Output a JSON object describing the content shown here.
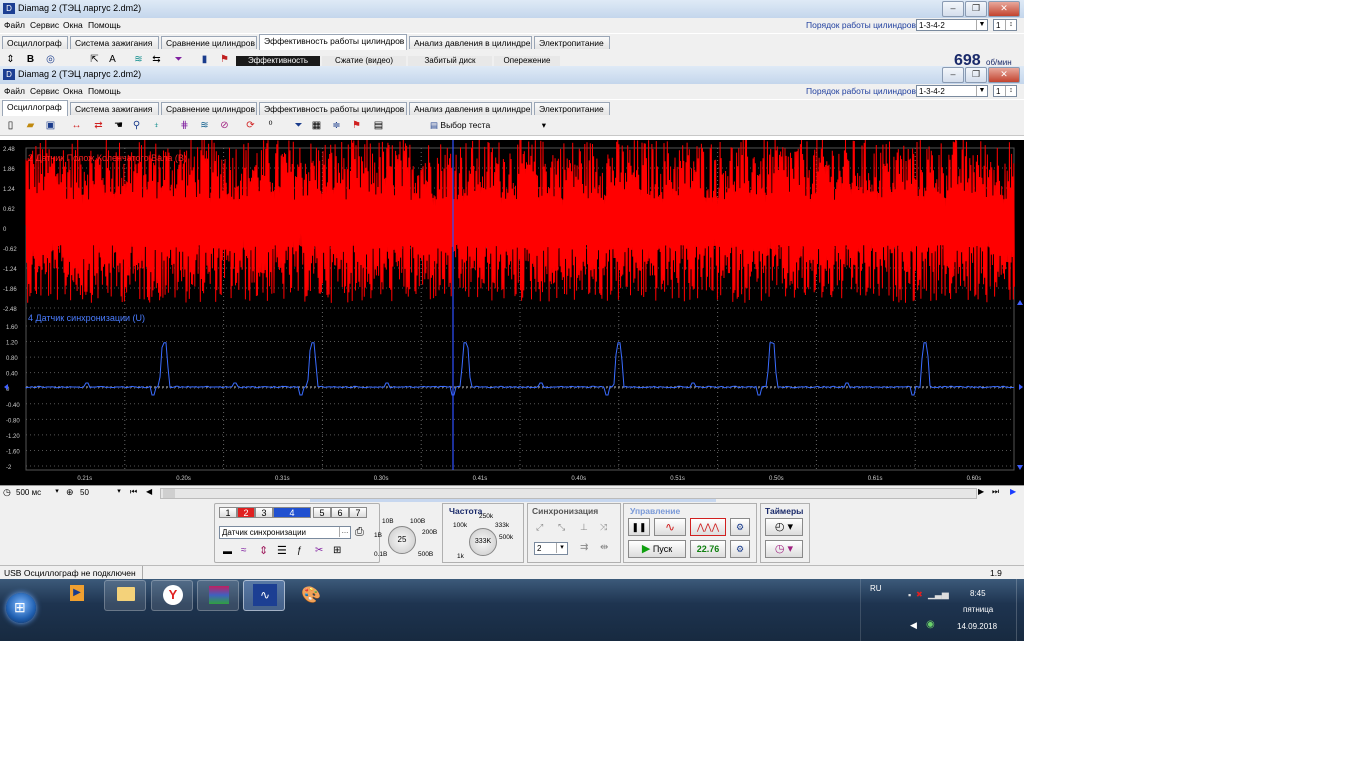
{
  "back_window": {
    "title": "Diamag 2 (ТЭЦ ларгус 2.dm2)",
    "menu": [
      "Файл",
      "Сервис",
      "Окна",
      "Помощь"
    ],
    "cylinder_order_label": "Порядок работы цилиндров",
    "cylinder_order_value": "1-3-4-2",
    "cylinder_index": "1",
    "tabs": [
      "Осциллограф",
      "Система зажигания",
      "Сравнение цилиндров",
      "Эффективность работы цилиндров",
      "Анализ давления в цилиндре",
      "Электропитание"
    ],
    "active_tab": 3,
    "subtabs": [
      "Эффективность",
      "Сжатие (видео)",
      "Забитый диск",
      "Опережение"
    ],
    "rpm_value": "698",
    "rpm_unit": "об/мин"
  },
  "front_window": {
    "title": "Diamag 2 (ТЭЦ ларгус 2.dm2)",
    "menu": [
      "Файл",
      "Сервис",
      "Окна",
      "Помощь"
    ],
    "cylinder_order_label": "Порядок работы цилиндров",
    "cylinder_order_value": "1-3-4-2",
    "cylinder_index": "1",
    "tabs": [
      "Осциллограф",
      "Система зажигания",
      "Сравнение цилиндров",
      "Эффективность работы цилиндров",
      "Анализ давления в цилиндре",
      "Электропитание"
    ],
    "active_tab": 0,
    "test_select": "Выбор теста"
  },
  "chart_data": {
    "type": "line",
    "x_tick_labels": [
      "0.21s",
      "0.20s",
      "0.31s",
      "0.30s",
      "0.41s",
      "0.40s",
      "0.51s",
      "0.50s",
      "0.61s",
      "0.60s"
    ],
    "grid": true,
    "series": [
      {
        "name": "2 Датчик Полож Коленчатого Вала (В)",
        "color": "#ff0000",
        "y_tick_labels": [
          "2.48",
          "1.86",
          "1.24",
          "0.62",
          "0",
          "-0.62",
          "-1.24",
          "-1.86",
          "-2.48"
        ],
        "ylim": [
          -2.48,
          2.48
        ],
        "amplitude_pos": 1.0,
        "amplitude_neg": -1.1
      },
      {
        "name": "4 Датчик синхронизации (U)",
        "color": "#3a6cff",
        "y_tick_labels": [
          "1.60",
          "1.20",
          "0.80",
          "0.40",
          "0",
          "-0.40",
          "-0.80",
          "-1.20",
          "-1.60",
          "-2"
        ],
        "ylim": [
          -2,
          1.6
        ],
        "pulse_peak": 0.95,
        "pulse_x_fractions": [
          0.14,
          0.29,
          0.445,
          0.6,
          0.755,
          0.91
        ]
      }
    ]
  },
  "bottom_bar": {
    "timebase": "500 мс",
    "zoom": "50"
  },
  "controls": {
    "channel_buttons": [
      "1",
      "2",
      "3",
      "4",
      "5",
      "6",
      "7"
    ],
    "active_channel": "4",
    "channel_select": "Датчик синхронизации",
    "gain_labels": [
      "10В",
      "100В",
      "1В",
      "200В",
      "0.1В",
      "500В"
    ],
    "gain_value": "25",
    "frequency_title": "Частота",
    "freq_labels": [
      "100k",
      "250k",
      "333k",
      "500k",
      "1k"
    ],
    "freq_value": "333K",
    "sync_title": "Синхронизация",
    "sync_channel": "2",
    "control_title": "Управление",
    "start_label": "Пуск",
    "fps_value": "22.76",
    "timers_title": "Таймеры"
  },
  "status": {
    "text": "USB Осциллограф не подключен",
    "right": "1.9"
  },
  "taskbar": {
    "lang": "RU",
    "time": "8:45",
    "day": "пятница",
    "date": "14.09.2018"
  }
}
